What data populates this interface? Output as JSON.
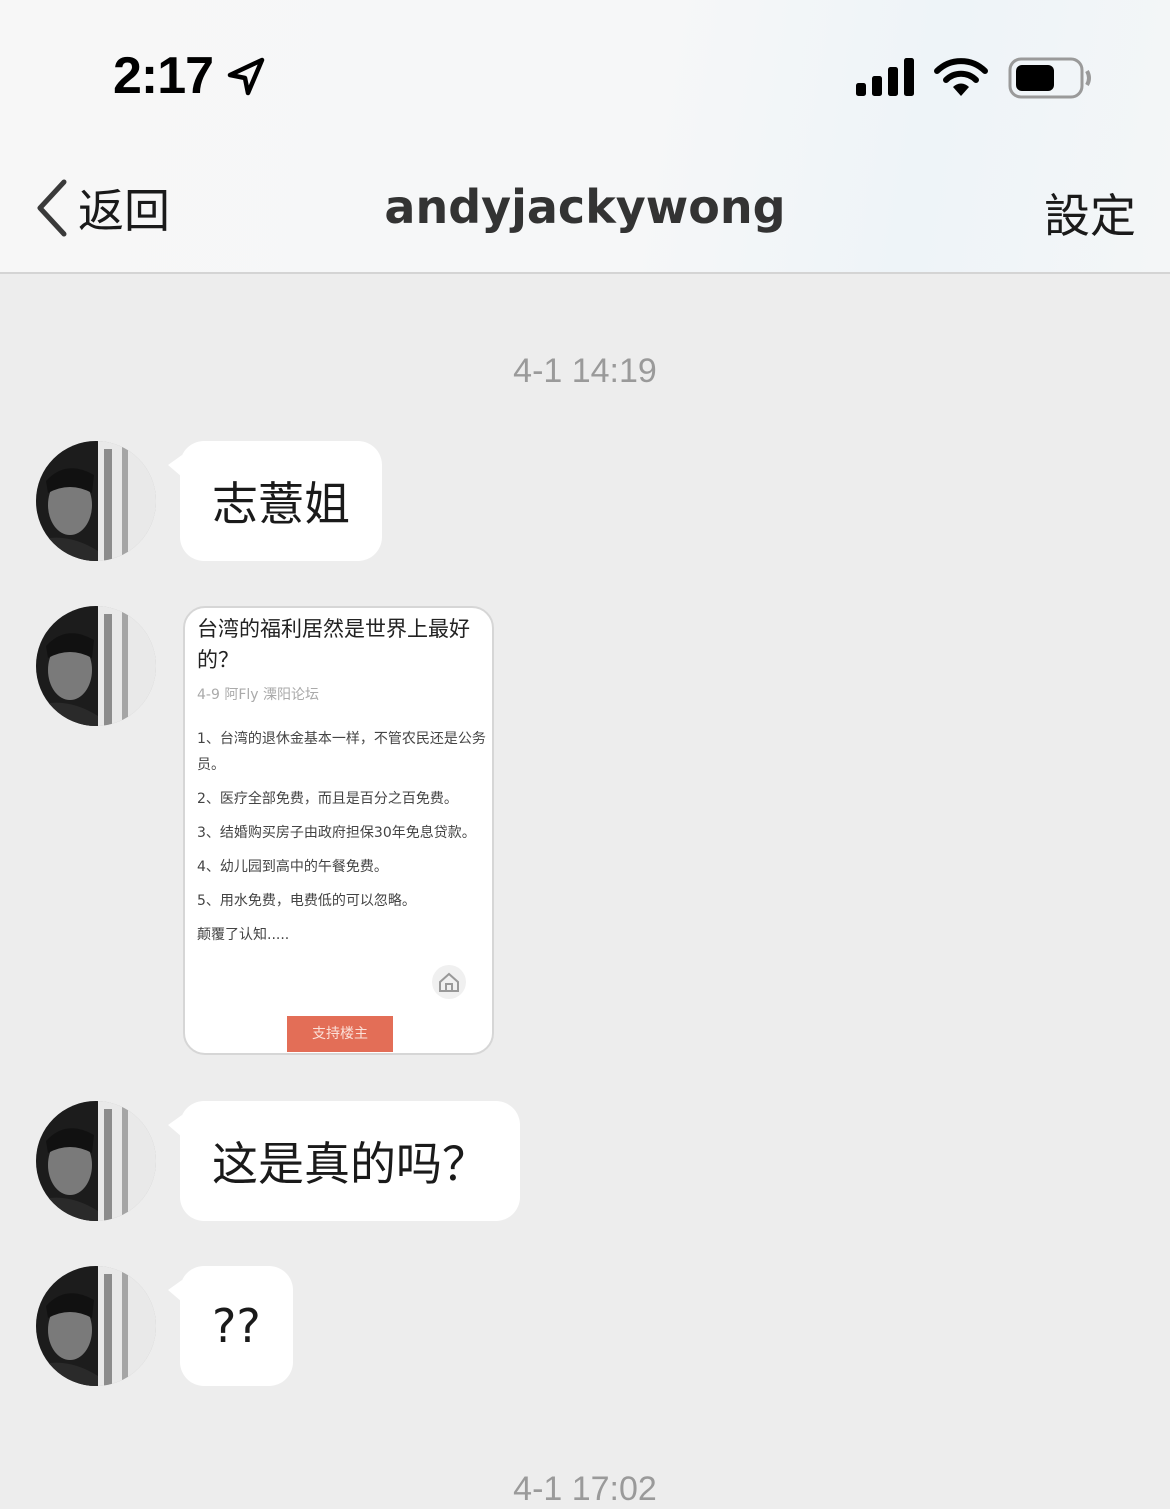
{
  "status_bar": {
    "time": "2:17"
  },
  "nav": {
    "back_label": "返回",
    "title": "andyjackywong",
    "settings_label": "設定"
  },
  "chat": {
    "timestamp": "4-1 14:19",
    "messages": [
      {
        "text": "志薏姐"
      },
      {
        "type": "image-card"
      },
      {
        "text": "这是真的吗？"
      },
      {
        "text": "??"
      }
    ],
    "card": {
      "title": "台湾的福利居然是世界上最好的？",
      "meta": "4-9  阿Fly  溧阳论坛",
      "lines": [
        "1、台湾的退休金基本一样，不管农民还是公务员。",
        "2、医疗全部免费，而且是百分之百免费。",
        "3、结婚购买房子由政府担保30年免息贷款。",
        "4、幼儿园到高中的午餐免费。",
        "5、用水免费，电费低的可以忽略。",
        "颠覆了认知....."
      ],
      "button_label": "支持楼主"
    },
    "timestamp_2": "4-1 17:02"
  },
  "icons": {
    "location": "location-arrow-icon",
    "signal": "cellular-signal-icon",
    "wifi": "wifi-icon",
    "battery": "battery-icon",
    "back": "chevron-left-icon",
    "home": "home-icon"
  }
}
